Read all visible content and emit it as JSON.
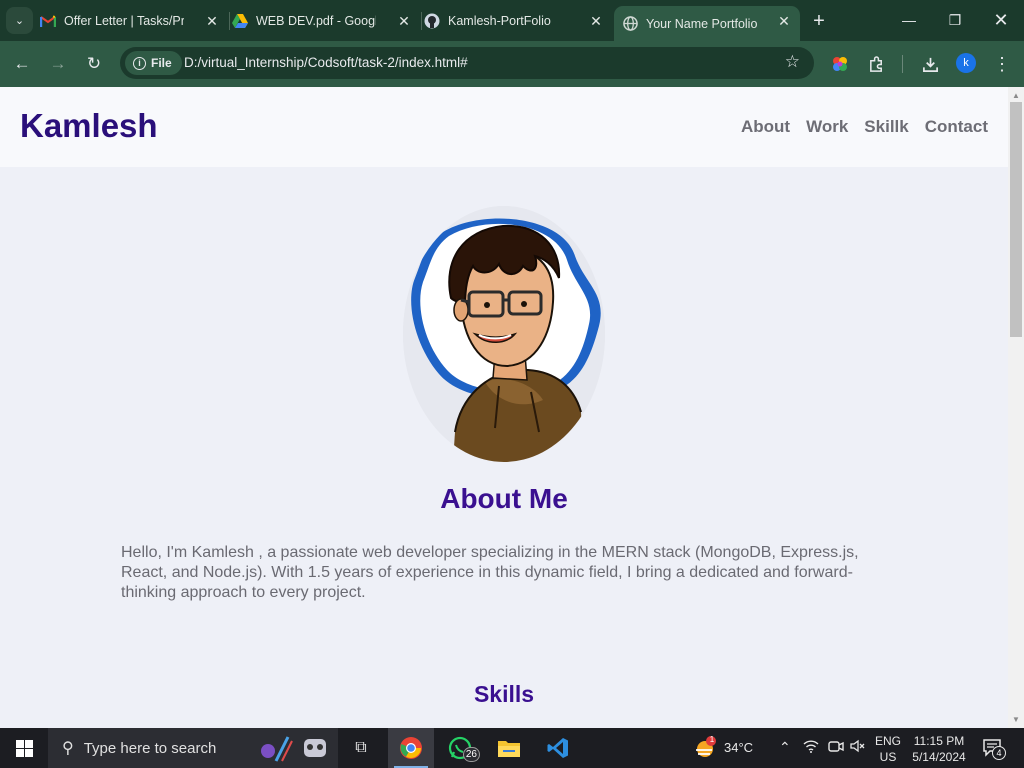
{
  "browser": {
    "tabs": [
      {
        "title": "Offer Letter | Tasks/Pro",
        "favicon": "gmail-icon"
      },
      {
        "title": "WEB DEV.pdf - Google",
        "favicon": "google-drive-icon"
      },
      {
        "title": "Kamlesh-PortFolio",
        "favicon": "github-icon"
      },
      {
        "title": "Your Name Portfolio",
        "favicon": "globe-icon",
        "active": true
      }
    ],
    "address_chip": "File",
    "url": "D:/virtual_Internship/Codsoft/task-2/index.html#",
    "profile_initial": "k"
  },
  "site": {
    "logo": "Kamlesh",
    "nav": [
      "About",
      "Work",
      "Skillk",
      "Contact"
    ],
    "about_title": "About Me",
    "about_text": "Hello, I'm Kamlesh , a passionate web developer specializing in the MERN stack (MongoDB, Express.js, React, and Node.js). With 1.5 years of experience in this dynamic field, I bring a dedicated and forward-thinking approach to every project.",
    "skills_title": "Skills"
  },
  "taskbar": {
    "search_placeholder": "Type here to search",
    "whatsapp_badge": "26",
    "weather_badge": "1",
    "temperature": "34°C",
    "language_line1": "ENG",
    "language_line2": "US",
    "time": "11:15 PM",
    "date": "5/14/2024",
    "notifications": "4"
  },
  "colors": {
    "chrome_dark": "#1b3a2c",
    "chrome_toolbar": "#2f5a45",
    "logo": "#2a0f7a",
    "heading": "#3a1090",
    "page_bg": "#eef0f7"
  }
}
